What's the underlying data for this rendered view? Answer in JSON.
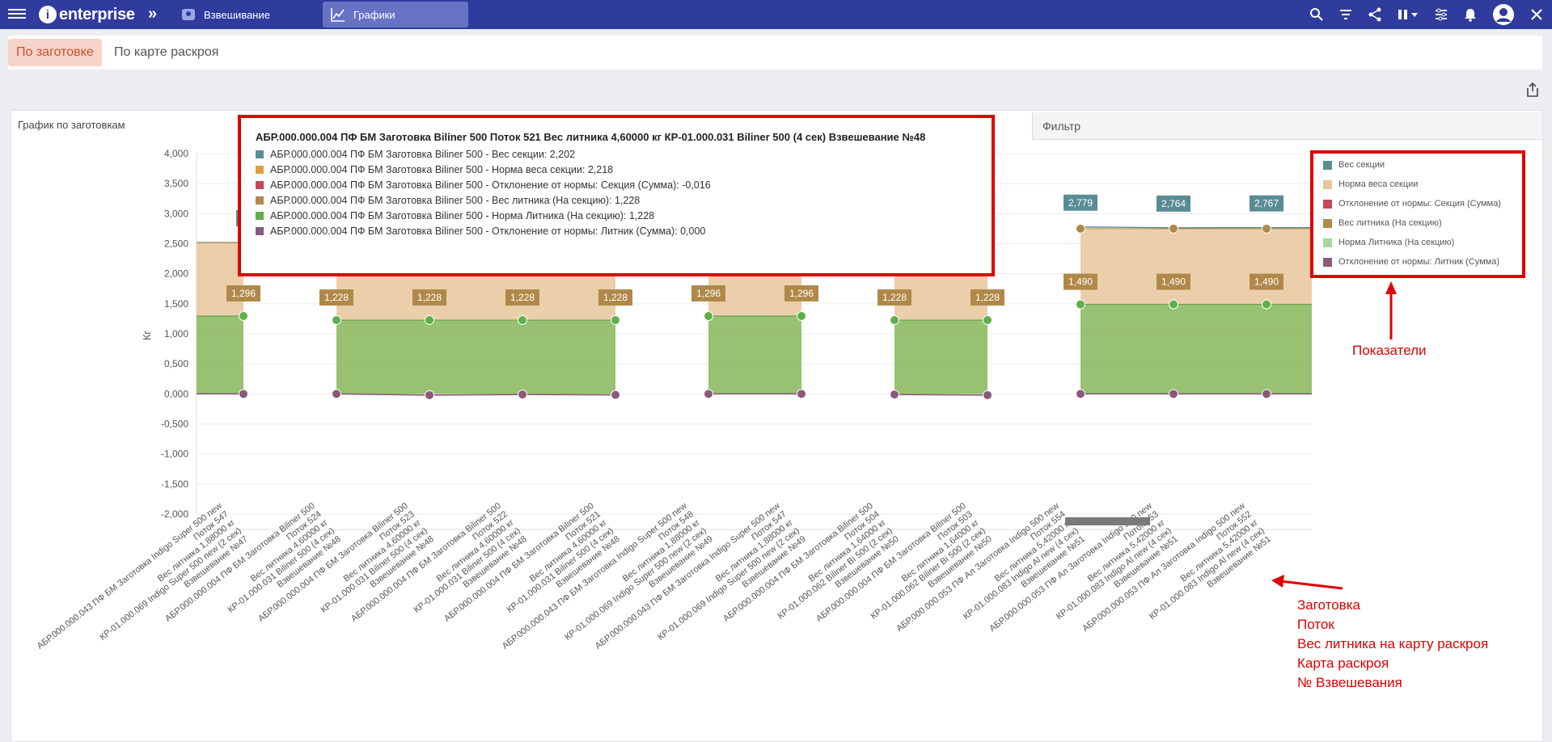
{
  "app": {
    "logo_text": "enterprise",
    "logo_letter": "i",
    "chevron": "»",
    "nav": [
      {
        "label": "Взвешивание",
        "icon": "scale-icon"
      },
      {
        "label": "Графики",
        "icon": "chart-icon"
      }
    ],
    "icons": [
      "search-icon",
      "filter-icon",
      "share-icon",
      "pause-icon",
      "settings-sliders-icon",
      "bell-icon",
      "user-avatar-icon",
      "close-icon"
    ]
  },
  "tabs": [
    {
      "label": "По заготовке",
      "active": true
    },
    {
      "label": "По карте раскроя",
      "active": false
    }
  ],
  "panel": {
    "title": "График по заготовкам",
    "filter_label": "Фильтр"
  },
  "colors": {
    "ves_sekcii": "#5a8c96",
    "norma_vesa": "#e6c79b",
    "otkl_sekcii": "#c8475a",
    "ves_litnika": "#b0894a",
    "norma_litnika": "#8fbf6a",
    "otkl_litnik": "#8a5a7a",
    "annotation": "#e00000",
    "header": "#2f3c9e"
  },
  "tooltip": {
    "title": "АБР.000.000.004 ПФ БМ Заготовка Biliner 500 Поток 521 Вес литника 4,60000 кг КР-01.000.031 Biliner 500 (4 сек) Взвешевание №48",
    "rows": [
      {
        "text": "АБР.000.000.004 ПФ БМ Заготовка Biliner 500 - Вес секции: 2,202",
        "color": "#5a8c96"
      },
      {
        "text": "АБР.000.000.004 ПФ БМ Заготовка Biliner 500 - Норма веса секции: 2,218",
        "color": "#e0a040"
      },
      {
        "text": "АБР.000.000.004 ПФ БМ Заготовка Biliner 500 - Отклонение от нормы: Секция (Сумма): -0,016",
        "color": "#c8475a"
      },
      {
        "text": "АБР.000.000.004 ПФ БМ Заготовка Biliner 500 - Вес литника (На секцию): 1,228",
        "color": "#b0894a"
      },
      {
        "text": "АБР.000.000.004 ПФ БМ Заготовка Biliner 500 - Норма Литника (На секцию): 1,228",
        "color": "#5fb04a"
      },
      {
        "text": "АБР.000.000.004 ПФ БМ Заготовка Biliner 500 - Отклонение от нормы: Литник (Сумма): 0,000",
        "color": "#8a5a7a"
      }
    ]
  },
  "legend": [
    {
      "label": "Вес секции",
      "color": "#5a8c96"
    },
    {
      "label": "Норма веса секции",
      "color": "#e6c79b"
    },
    {
      "label": "Отклонение от нормы: Секция (Сумма)",
      "color": "#c8475a"
    },
    {
      "label": "Вес литника (На секцию)",
      "color": "#b0894a"
    },
    {
      "label": "Норма Литника (На секцию)",
      "color": "#a8d89a"
    },
    {
      "label": "Отклонение от нормы: Литник (Сумма)",
      "color": "#8a5a7a"
    }
  ],
  "annotations": {
    "legend_note": "Показатели",
    "axis_note": [
      "Заготовка",
      "Поток",
      "Вес литника на карту раскроя",
      "Карта раскроя",
      "№ Взвешевания"
    ]
  },
  "chart_data": {
    "type": "area",
    "ylabel": "Кг",
    "ylim": [
      -2000,
      4000
    ],
    "yticks": [
      "4,000",
      "3,500",
      "3,000",
      "2,500",
      "2,000",
      "1,500",
      "1,000",
      "0,500",
      "0,000",
      "-0,500",
      "-1,000",
      "-1,500",
      "-2,000"
    ],
    "groups": [
      {
        "labels": [
          [
            "АБР.000.000.043 ПФ БМ Заготовка Indigo Super 500 new",
            "Поток 547",
            "Вес литника 1,88000 кг",
            "КР-01.000.069 Indigo Super 500 new (2 сек)",
            "Взвешевание №47"
          ]
        ]
      },
      {
        "labels": [
          [
            "АБР.000.000.004 ПФ БМ Заготовка Biliner 500",
            "Поток 524",
            "Вес литника 4,60000 кг",
            "КР-01.000.031 Biliner 500 (4 сек)",
            "Взвешевание №48"
          ],
          [
            "АБР.000.000.004 ПФ БМ Заготовка Biliner 500",
            "Поток 523",
            "Вес литника 4,60000 кг",
            "КР-01.000.031 Biliner 500 (4 сек)",
            "Взвешевание №48"
          ],
          [
            "АБР.000.000.004 ПФ БМ Заготовка Biliner 500",
            "Поток 522",
            "Вес литника 4,60000 кг",
            "КР-01.000.031 Biliner 500 (4 сек)",
            "Взвешевание №48"
          ],
          [
            "АБР.000.000.004 ПФ БМ Заготовка Biliner 500",
            "Поток 521",
            "Вес литника 4,60000 кг",
            "КР-01.000.031 Biliner 500 (4 сек)",
            "Взвешевание №48"
          ]
        ]
      },
      {
        "labels": [
          [
            "АБР.000.000.043 ПФ БМ Заготовка Indigo Super 500 new",
            "Поток 548",
            "Вес литника 1,88000 кг",
            "КР-01.000.069 Indigo Super 500 new (2 сек)",
            "Взвешевание №49"
          ],
          [
            "АБР.000.000.043 ПФ БМ Заготовка Indigo Super 500 new",
            "Поток 547",
            "Вес литника 1,88000 кг",
            "КР-01.000.069 Indigo Super 500 new (2 сек)",
            "Взвешевание №49"
          ]
        ]
      },
      {
        "labels": [
          [
            "АБР.000.000.004 ПФ БМ Заготовка Biliner 500",
            "Поток 504",
            "Вес литника 1,64000 кг",
            "КР-01.000.062 Biliner Bi 500 (2 сек)",
            "Взвешевание №50"
          ],
          [
            "АБР.000.000.004 ПФ БМ Заготовка Biliner 500",
            "Поток 503",
            "Вес литника 1,64000 кг",
            "КР-01.000.062 Biliner Bi 500 (2 сек)",
            "Взвешевание №50"
          ]
        ]
      },
      {
        "labels": [
          [
            "АБР.000.000.053 ПФ Ал Заготовка Indigo 500 new",
            "Поток 554",
            "Вес литника 5,42000 кг",
            "КР-01.000.083 Indigo Al new (4 сек)",
            "Взвешевание №51"
          ],
          [
            "АБР.000.000.053 ПФ Ал Заготовка Indigo 500 new",
            "Поток 553",
            "Вес литника 5,42000 кг",
            "КР-01.000.083 Indigo Al new (4 сек)",
            "Взвешевание №51"
          ],
          [
            "АБР.000.000.053 ПФ Ал Заготовка Indigo 500 new",
            "Поток 552",
            "Вес литника 5,42000 кг",
            "КР-01.000.083 Indigo Al new (4 сек)",
            "Взвешевание №51"
          ]
        ]
      }
    ],
    "points": [
      {
        "sec": 2.52,
        "norm": 2.52,
        "gate": 1.296,
        "dev": 0.0,
        "sec_label": "2",
        "gate_label": "1,296"
      },
      {
        "sec": 2.2,
        "norm": 2.218,
        "gate": 1.228,
        "dev": 0.0,
        "gate_label": "1,228"
      },
      {
        "sec": 2.2,
        "norm": 2.218,
        "gate": 1.228,
        "dev": -0.02,
        "gate_label": "1,228"
      },
      {
        "sec": 2.2,
        "norm": 2.218,
        "gate": 1.228,
        "dev": -0.01,
        "gate_label": "1,228"
      },
      {
        "sec": 2.202,
        "norm": 2.218,
        "gate": 1.228,
        "dev": -0.016,
        "gate_label": "1,228"
      },
      {
        "sec": 2.65,
        "norm": 2.65,
        "gate": 1.296,
        "dev": 0.0,
        "gate_label": "1,296"
      },
      {
        "sec": 2.65,
        "norm": 2.65,
        "gate": 1.296,
        "dev": 0.0,
        "gate_label": "1,296"
      },
      {
        "sec": 2.2,
        "norm": 2.218,
        "gate": 1.228,
        "dev": -0.01,
        "gate_label": "1,228"
      },
      {
        "sec": 2.2,
        "norm": 2.218,
        "gate": 1.228,
        "dev": -0.02,
        "sec_label": "3",
        "gate_label": "1,228"
      },
      {
        "sec": 2.779,
        "norm": 2.75,
        "gate": 1.49,
        "dev": 0.0,
        "sec_label": "2,779",
        "gate_label": "1,490"
      },
      {
        "sec": 2.764,
        "norm": 2.75,
        "gate": 1.49,
        "dev": 0.0,
        "sec_label": "2,764",
        "gate_label": "1,490"
      },
      {
        "sec": 2.767,
        "norm": 2.75,
        "gate": 1.49,
        "dev": 0.0,
        "sec_label": "2,767",
        "gate_label": "1,490"
      }
    ]
  }
}
